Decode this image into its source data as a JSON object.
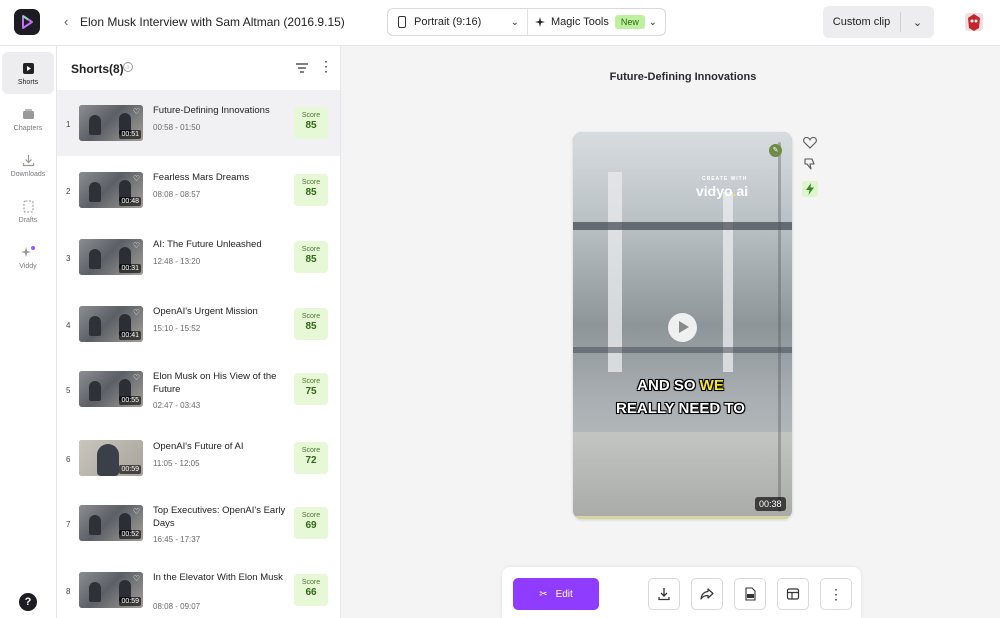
{
  "header": {
    "back_icon": "chevron-left-icon",
    "video_title": "Elon Musk Interview with Sam Altman (2016.9.15)",
    "aspect_label": "Portrait (9:16)",
    "magic_tools_label": "Magic Tools",
    "new_badge": "New",
    "custom_clip_label": "Custom clip"
  },
  "rail": {
    "items": [
      {
        "label": "Shorts",
        "icon": "shorts-icon"
      },
      {
        "label": "Chapters",
        "icon": "chapters-icon"
      },
      {
        "label": "Downloads",
        "icon": "download-icon"
      },
      {
        "label": "Drafts",
        "icon": "drafts-icon"
      },
      {
        "label": "Viddy",
        "icon": "sparkle-icon"
      }
    ],
    "help_label": "?"
  },
  "panel": {
    "title": "Shorts(8)",
    "info_glyph": "i",
    "more_glyph": "⋮",
    "score_label": "Score",
    "items": [
      {
        "num": "1",
        "title": "Future-Defining Innovations",
        "time": "00:58 - 01:50",
        "duration": "00:51",
        "score": "85"
      },
      {
        "num": "2",
        "title": "Fearless Mars Dreams",
        "time": "08:08 - 08:57",
        "duration": "00:48",
        "score": "85"
      },
      {
        "num": "3",
        "title": "AI: The Future Unleashed",
        "time": "12:48 - 13:20",
        "duration": "00:31",
        "score": "85"
      },
      {
        "num": "4",
        "title": "OpenAI's Urgent Mission",
        "time": "15:10 - 15:52",
        "duration": "00:41",
        "score": "85"
      },
      {
        "num": "5",
        "title": "Elon Musk on His View of the Future",
        "time": "02:47 - 03:43",
        "duration": "00:55",
        "score": "75"
      },
      {
        "num": "6",
        "title": "OpenAI's Future of AI",
        "time": "11:05 - 12:05",
        "duration": "00:59",
        "score": "72"
      },
      {
        "num": "7",
        "title": "Top Executives: OpenAI's Early Days",
        "time": "16:45 - 17:37",
        "duration": "00:52",
        "score": "69"
      },
      {
        "num": "8",
        "title": "In the Elevator With Elon Musk",
        "time": "08:08 - 09:07",
        "duration": "00:59",
        "score": "66"
      }
    ]
  },
  "preview": {
    "title": "Future-Defining Innovations",
    "watermark_small": "CREATE WITH",
    "watermark_main": "vidyo",
    "watermark_dot": ".",
    "watermark_end": "ai",
    "caption_line1_a": "AND SO ",
    "caption_line1_b": "WE",
    "caption_line2": "REALLY NEED TO",
    "duration": "00:38",
    "side_actions": [
      "heart-icon",
      "thumbs-down-icon",
      "bolt-icon"
    ]
  },
  "bottom": {
    "edit_label": "Edit",
    "icons": [
      "download-icon",
      "share-icon",
      "srt-icon",
      "layout-icon",
      "more-icon"
    ],
    "more_glyph": "⋮"
  },
  "colors": {
    "accent": "#8f3cff",
    "score_bg": "#e6f8d6",
    "score_text": "#2f6a14",
    "new_badge_bg": "#bff0a0",
    "caption_highlight": "#f7e63a"
  }
}
